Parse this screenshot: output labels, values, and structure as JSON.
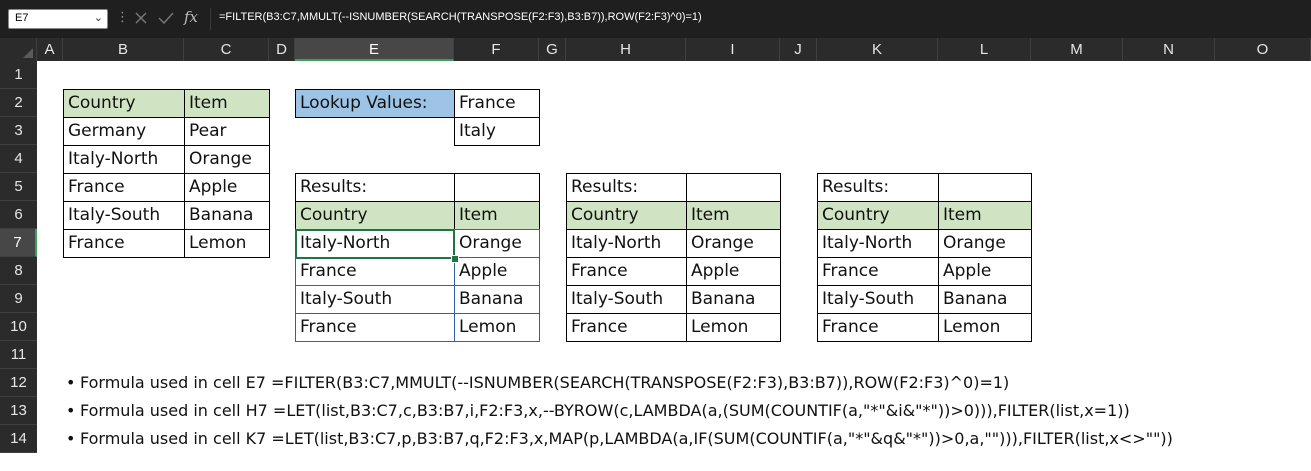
{
  "formula_bar": {
    "name_box": "E7",
    "formula": "=FILTER(B3:C7,MMULT(--ISNUMBER(SEARCH(TRANSPOSE(F2:F3),B3:B7)),ROW(F2:F3)^0)=1)",
    "fx_label": "fx"
  },
  "columns": [
    "A",
    "B",
    "C",
    "D",
    "E",
    "F",
    "G",
    "H",
    "I",
    "J",
    "K",
    "L",
    "M",
    "N",
    "O"
  ],
  "rows": [
    "1",
    "2",
    "3",
    "4",
    "5",
    "6",
    "7",
    "8",
    "9",
    "10",
    "11",
    "12",
    "13",
    "14"
  ],
  "source_table": {
    "headers": [
      "Country",
      "Item"
    ],
    "rows": [
      [
        "Germany",
        "Pear"
      ],
      [
        "Italy-North",
        "Orange"
      ],
      [
        "France",
        "Apple"
      ],
      [
        "Italy-South",
        "Banana"
      ],
      [
        "France",
        "Lemon"
      ]
    ]
  },
  "lookup": {
    "label": "Lookup Values:",
    "values": [
      "France",
      "Italy"
    ]
  },
  "results": [
    {
      "title": "Results:",
      "headers": [
        "Country",
        "Item"
      ],
      "rows": [
        [
          "Italy-North",
          "Orange"
        ],
        [
          "France",
          "Apple"
        ],
        [
          "Italy-South",
          "Banana"
        ],
        [
          "France",
          "Lemon"
        ]
      ]
    },
    {
      "title": "Results:",
      "headers": [
        "Country",
        "Item"
      ],
      "rows": [
        [
          "Italy-North",
          "Orange"
        ],
        [
          "France",
          "Apple"
        ],
        [
          "Italy-South",
          "Banana"
        ],
        [
          "France",
          "Lemon"
        ]
      ]
    },
    {
      "title": "Results:",
      "headers": [
        "Country",
        "Item"
      ],
      "rows": [
        [
          "Italy-North",
          "Orange"
        ],
        [
          "France",
          "Apple"
        ],
        [
          "Italy-South",
          "Banana"
        ],
        [
          "France",
          "Lemon"
        ]
      ]
    }
  ],
  "notes": [
    "Formula used in cell E7 =FILTER(B3:C7,MMULT(--ISNUMBER(SEARCH(TRANSPOSE(F2:F3),B3:B7)),ROW(F2:F3)^0)=1)",
    "Formula used in cell H7 =LET(list,B3:C7,c,B3:B7,i,F2:F3,x,--BYROW(c,LAMBDA(a,(SUM(COUNTIF(a,\"*\"&i&\"*\"))>0))),FILTER(list,x=1))",
    "Formula used in cell K7 =LET(list,B3:C7,p,B3:B7,q,F2:F3,x,MAP(p,LAMBDA(a,IF(SUM(COUNTIF(a,\"*\"&q&\"*\"))>0,a,\"\"))),FILTER(list,x<>\"\"))"
  ],
  "bullet": "•",
  "colors": {
    "header_green": "#d0e4c4",
    "lookup_blue": "#9dc3e6",
    "selection_green": "#217346",
    "ui_dark": "#1f1f1f"
  }
}
